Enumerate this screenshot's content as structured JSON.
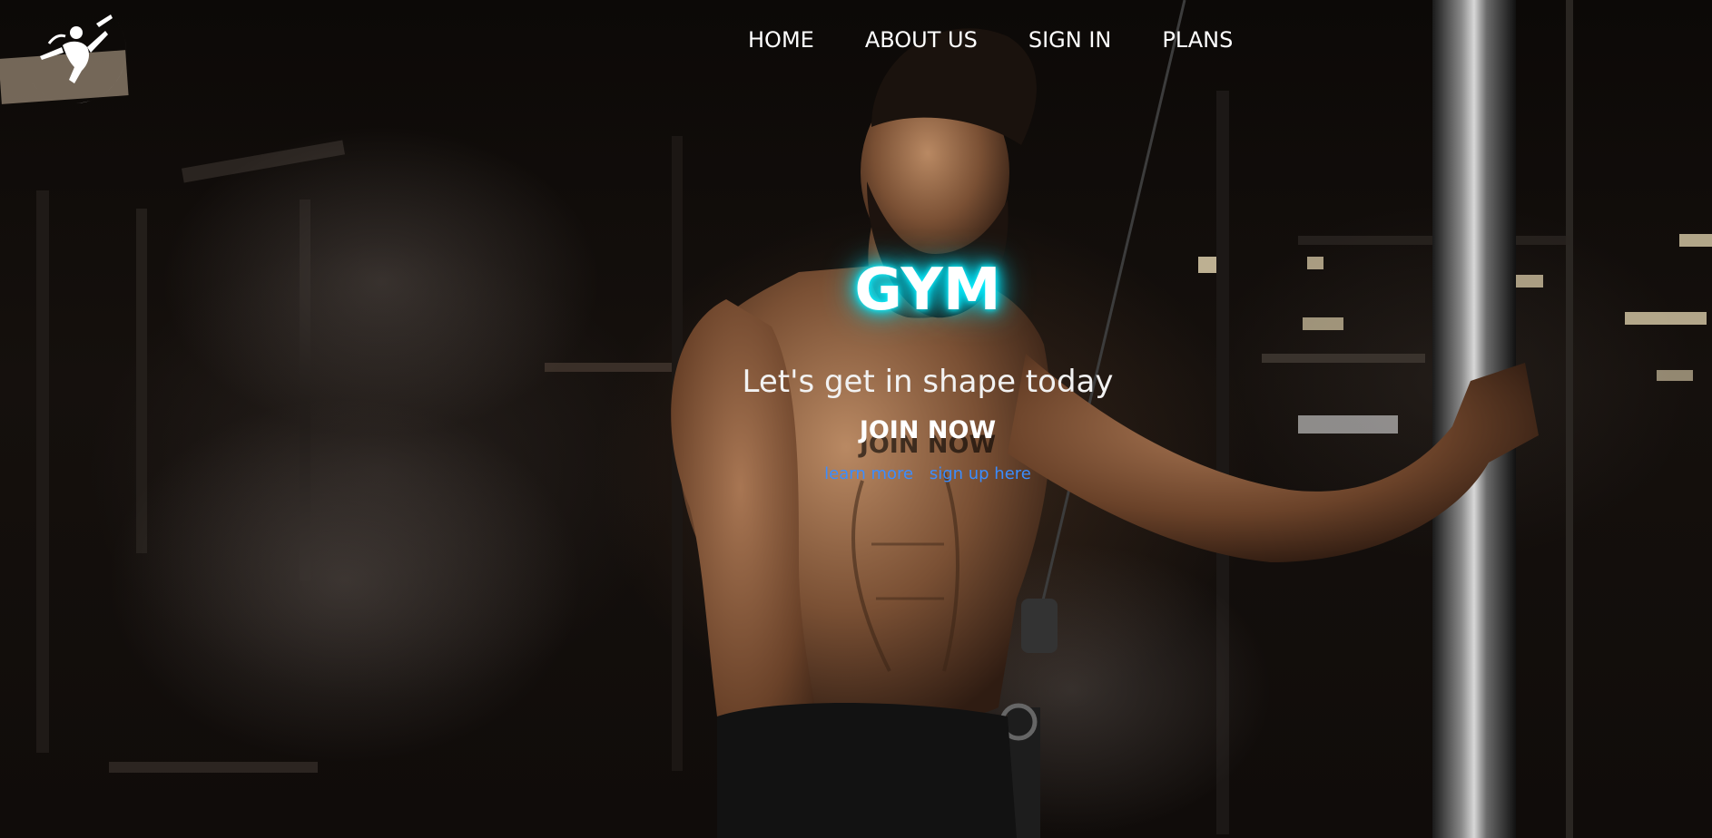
{
  "nav": {
    "items": [
      {
        "label": "HOME"
      },
      {
        "label": "ABOUT US"
      },
      {
        "label": "SIGN IN"
      },
      {
        "label": "PLANS"
      }
    ]
  },
  "hero": {
    "title": "GYM",
    "subtitle": "Let's get in shape today",
    "cta_label": "JOIN NOW",
    "learn_more": "learn more",
    "sign_up": "sign up here"
  },
  "colors": {
    "title_glow": "#00e8ff",
    "link": "#3b8dff",
    "text": "#ffffff"
  },
  "icons": {
    "logo": "athlete-logo-icon"
  }
}
